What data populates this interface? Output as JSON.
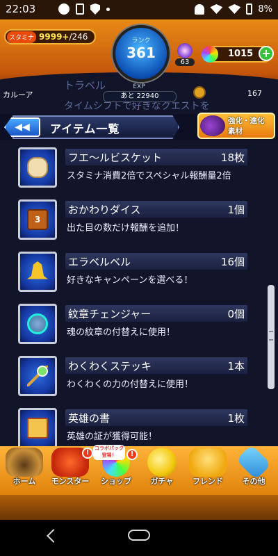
{
  "status_bar": {
    "time": "22:03",
    "battery": "8%"
  },
  "header": {
    "stamina_label": "スタミナ",
    "stamina_value": "9999+",
    "stamina_max": "/246",
    "rank_label": "ランク",
    "rank_value": "361",
    "exp_label": "EXP",
    "exp_next": "あと 22940",
    "orb_small_count": "63",
    "orbs": "1015",
    "plus": "+"
  },
  "background": {
    "name": "カルーア",
    "ghost1": "トラベル",
    "ghost2": "タイムシフトで好きなクエストを",
    "count": "167"
  },
  "titlebar": {
    "title": "アイテム一覧",
    "back_glyph": "◀◀"
  },
  "evolve_button": {
    "line1": "強化・進化",
    "line2": "素材"
  },
  "items": [
    {
      "name": "フエ～ルビスケット",
      "count": "18枚",
      "desc": "スタミナ消費2倍でスペシャル報酬量2倍",
      "icon": "biscuit-icon"
    },
    {
      "name": "おかわりダイス",
      "count": "1個",
      "desc": "出た目の数だけ報酬を追加！",
      "icon": "dice-icon"
    },
    {
      "name": "エラベルベル",
      "count": "16個",
      "desc": "好きなキャンペーンを選べる！",
      "icon": "bell-icon"
    },
    {
      "name": "紋章チェンジャー",
      "count": "0個",
      "desc": "魂の紋章の付替えに使用！",
      "icon": "badge-changer-icon"
    },
    {
      "name": "わくわくステッキ",
      "count": "1本",
      "desc": "わくわくの力の付替えに使用！",
      "icon": "magic-stick-icon"
    },
    {
      "name": "英雄の書",
      "count": "1枚",
      "desc": "英雄の証が獲得可能！",
      "icon": "scroll-icon"
    }
  ],
  "nav": {
    "home": "ホーム",
    "monster": "モンスター",
    "shop": "ショップ",
    "gacha": "ガチャ",
    "friend": "フレンド",
    "other": "その他",
    "collab": "コラボパック登場！",
    "alert": "!"
  },
  "colors": {
    "header_orange": "#e88a16",
    "list_bg": "#12142a",
    "nav_orange": "#ffb33a"
  }
}
